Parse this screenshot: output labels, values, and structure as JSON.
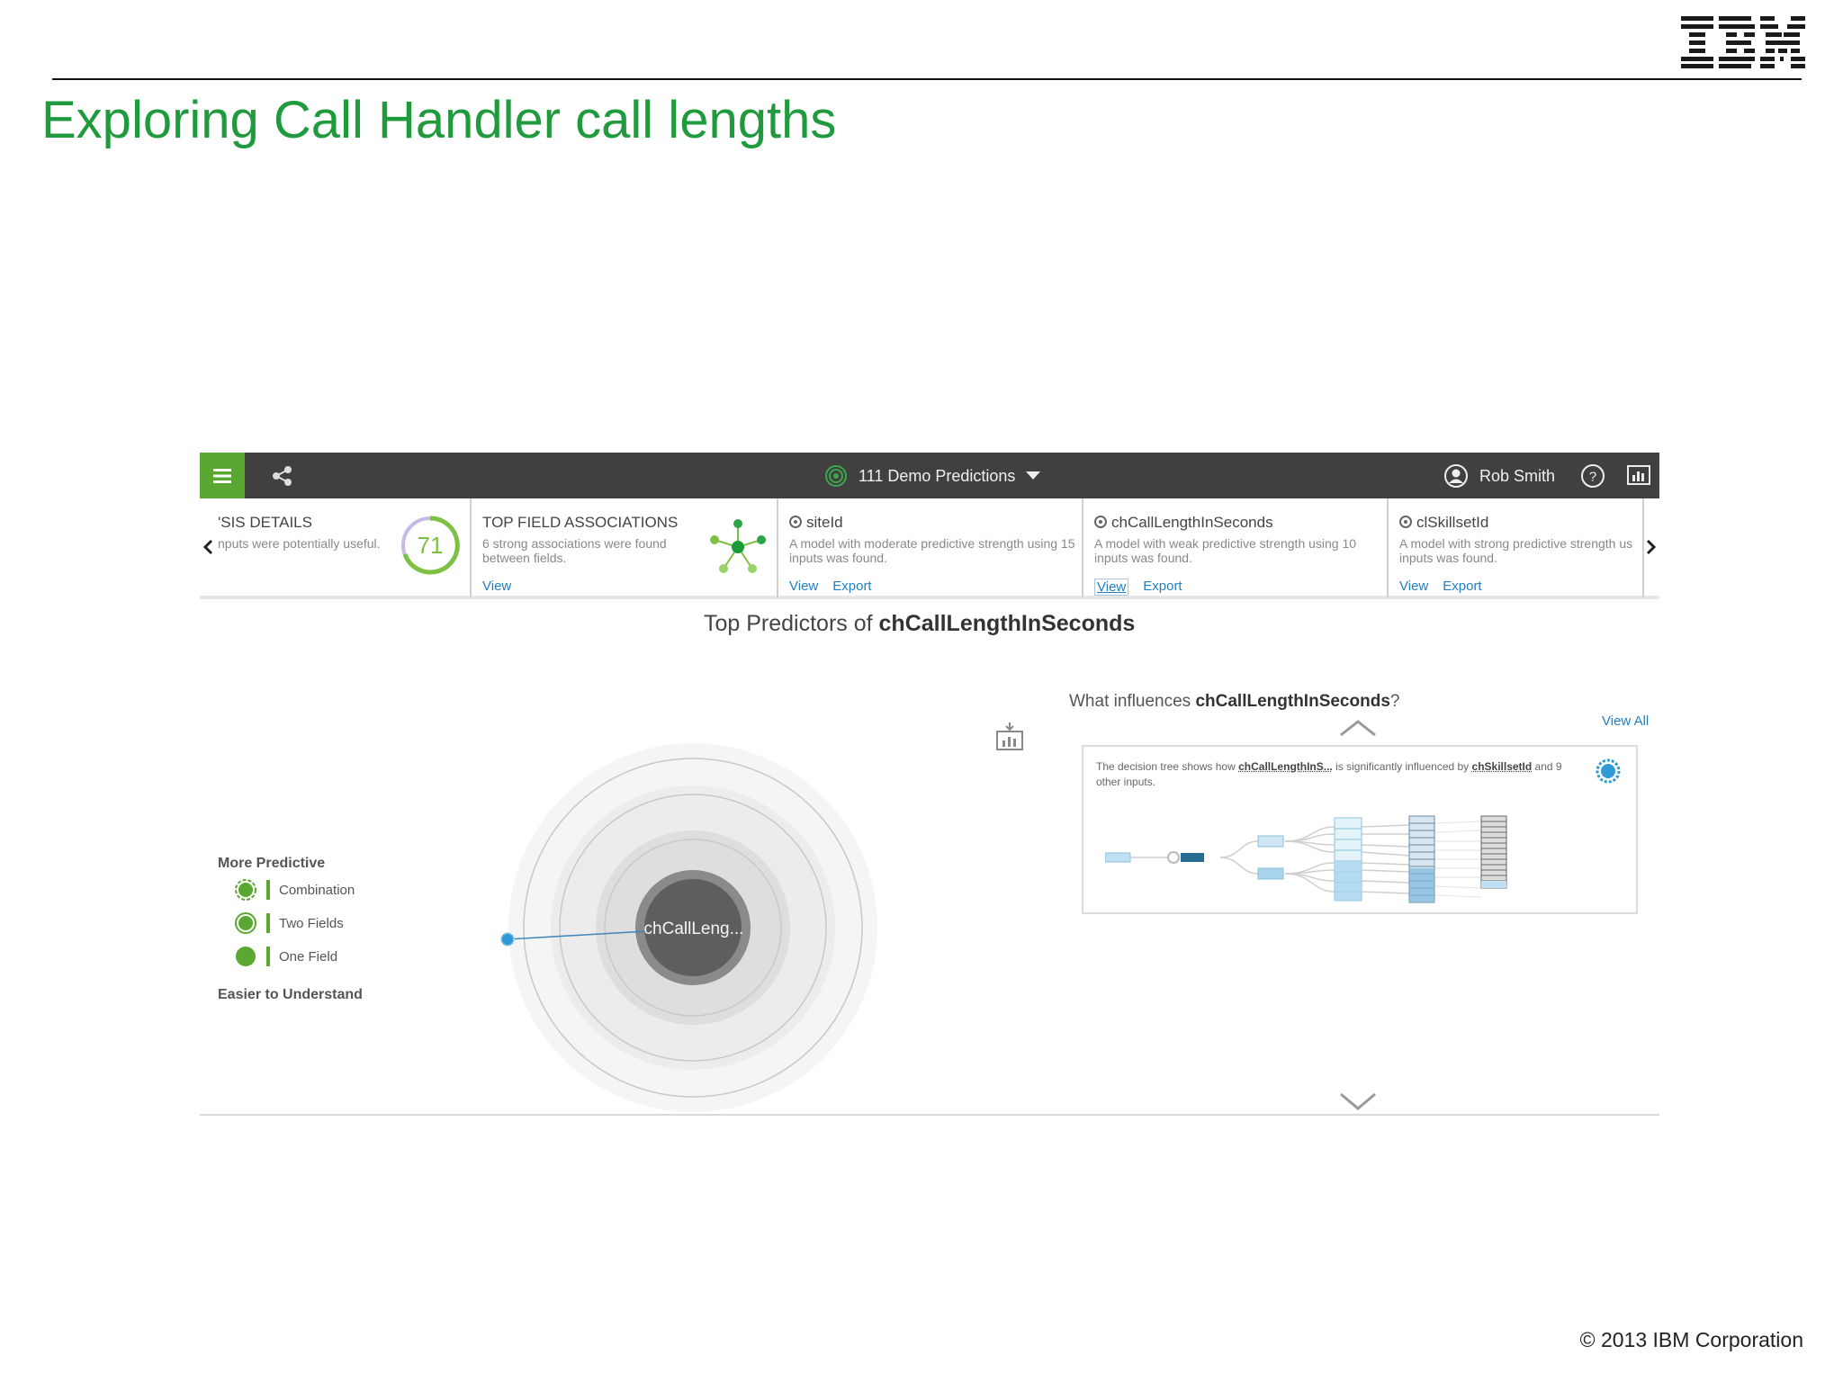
{
  "slide": {
    "title": "Exploring Call Handler call lengths",
    "logo_text": "IBM",
    "copyright": "© 2013 IBM Corporation",
    "title_color": "#1f9a3c"
  },
  "app": {
    "colors": {
      "topbar": "#404040",
      "accent_green": "#5aa832",
      "link_blue": "#1f7fc2"
    },
    "topbar": {
      "menu_icon": "hamburger-icon",
      "share_icon": "share-icon",
      "project_icon": "radar-icon",
      "project_name": "111 Demo Predictions",
      "dropdown_icon": "caret-down-icon",
      "user_icon": "user-avatar-icon",
      "user_name": "Rob Smith",
      "help_icon": "help-icon",
      "report_icon": "report-icon"
    },
    "cards": [
      {
        "title": "'SIS DETAILS",
        "desc": "nputs were potentially useful.",
        "score": "71",
        "links": []
      },
      {
        "title": "TOP FIELD ASSOCIATIONS",
        "desc": "6 strong associations were found between fields.",
        "links": [
          "View"
        ]
      },
      {
        "title": "siteId",
        "desc": "A model with moderate predictive strength using 15 inputs was found.",
        "links": [
          "View",
          "Export"
        ]
      },
      {
        "title": "chCallLengthInSeconds",
        "desc": "A model with weak predictive strength using 10 inputs was found.",
        "links": [
          "View",
          "Export"
        ]
      },
      {
        "title": "clSkillsetId",
        "desc": "A model with strong predictive strength us inputs was found.",
        "links": [
          "View",
          "Export"
        ]
      }
    ],
    "main": {
      "title_prefix": "Top Predictors of ",
      "title_field": "chCallLengthInSeconds"
    },
    "legend": {
      "top": "More Predictive",
      "items": [
        "Combination",
        "Two Fields",
        "One Field"
      ],
      "bottom": "Easier to Understand"
    },
    "bubble": {
      "center_label": "chCallLeng..."
    },
    "influence": {
      "title_prefix": "What influences ",
      "title_field": "chCallLengthInSeconds",
      "title_suffix": "?",
      "view_all": "View All",
      "desc_prefix": "The decision tree shows how ",
      "desc_target": "chCallLengthInS...",
      "desc_mid": " is significantly influenced by ",
      "desc_field": "chSkillsetId",
      "desc_suffix": " and 9 other inputs."
    }
  }
}
